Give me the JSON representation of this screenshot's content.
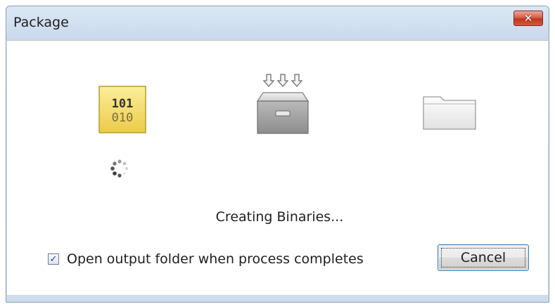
{
  "window": {
    "title": "Package",
    "close_icon": "close-icon",
    "close_glyph": "✕"
  },
  "stages": [
    {
      "icon": "binary-file-icon",
      "text_top": "101",
      "text_bottom": "010",
      "active": true
    },
    {
      "icon": "archive-box-icon",
      "active": false
    },
    {
      "icon": "folder-icon",
      "active": false
    }
  ],
  "progress": {
    "spinner_icon": "loading-spinner-icon",
    "status_text": "Creating Binaries..."
  },
  "options": {
    "open_output_folder_label": "Open output folder when process completes",
    "open_output_folder_checked": true,
    "check_glyph": "✓"
  },
  "actions": {
    "cancel_label": "Cancel"
  },
  "colors": {
    "active_stage_bg": "#f3dc6a",
    "close_button": "#c9452c",
    "button_border": "#3c7fb1"
  }
}
